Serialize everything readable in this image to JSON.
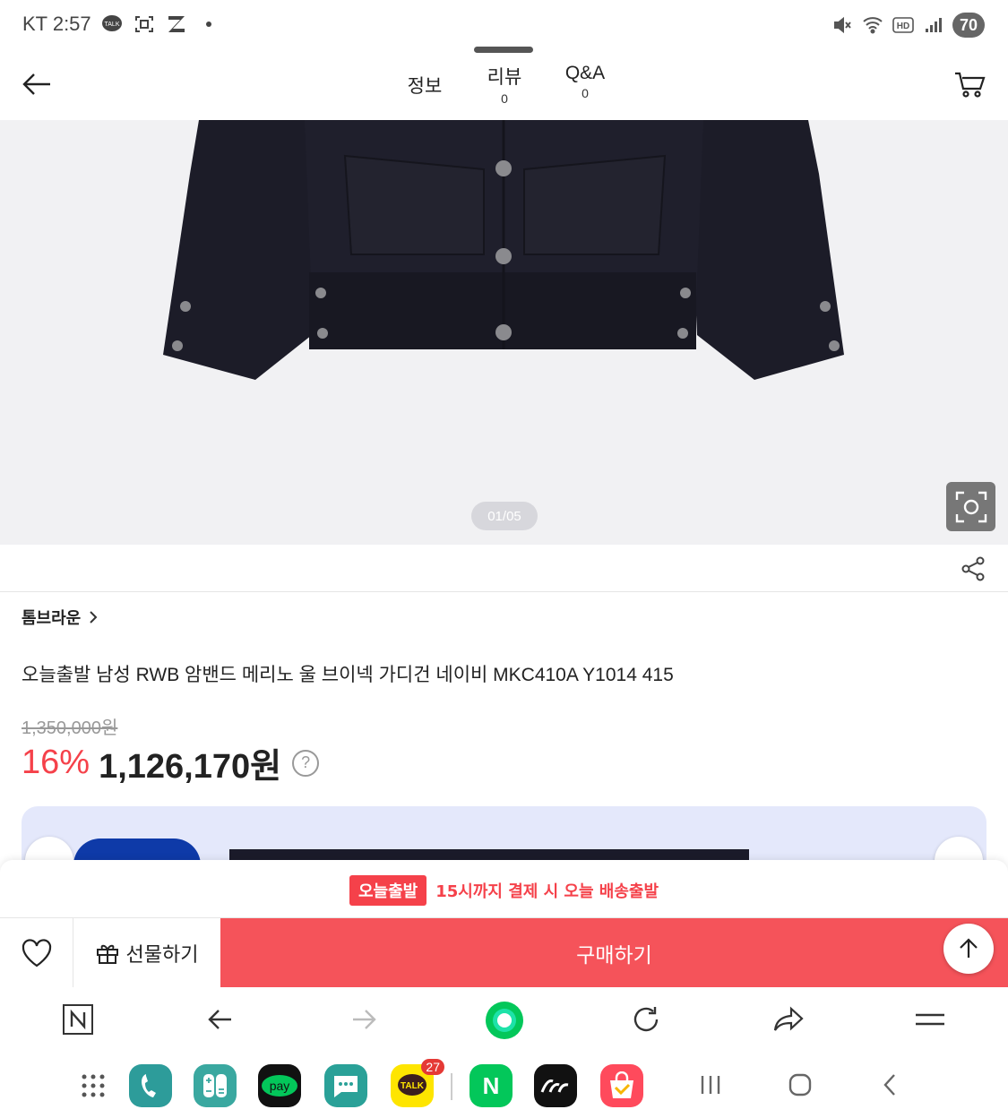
{
  "status_bar": {
    "carrier_time": "KT 2:57",
    "battery": "70",
    "left_icons": [
      "talk-icon",
      "screenshot-icon",
      "z-icon",
      "dot-icon"
    ],
    "right_icons": [
      "mute-icon",
      "wifi-icon",
      "hd-icon",
      "signal-icon"
    ]
  },
  "header": {
    "tabs": [
      {
        "label": "정보",
        "count": ""
      },
      {
        "label": "리뷰",
        "count": "0"
      },
      {
        "label": "Q&A",
        "count": "0"
      }
    ]
  },
  "gallery": {
    "page_indicator": "01/05"
  },
  "product": {
    "brand": "톰브라운",
    "title": "오늘출발 남성 RWB 암밴드 메리노 울 브이넥 가디건 네이비 MKC410A Y1014 415",
    "original_price": "1,350,000원",
    "discount": "16%",
    "price": "1,126,170원",
    "help": "?"
  },
  "delivery": {
    "badge": "오늘출발",
    "text": "15시까지 결제 시 오늘 배송출발"
  },
  "actions": {
    "gift_label": "선물하기",
    "buy_label": "구매하기"
  },
  "dock": {
    "kakaotalk_badge": "27",
    "kakaotalk_label": "TALK",
    "pay_label": "pay",
    "naver_label": "N"
  },
  "colors": {
    "accent_red": "#f5414a",
    "buy_button": "#f5535a",
    "naver_green": "#03c75a"
  }
}
